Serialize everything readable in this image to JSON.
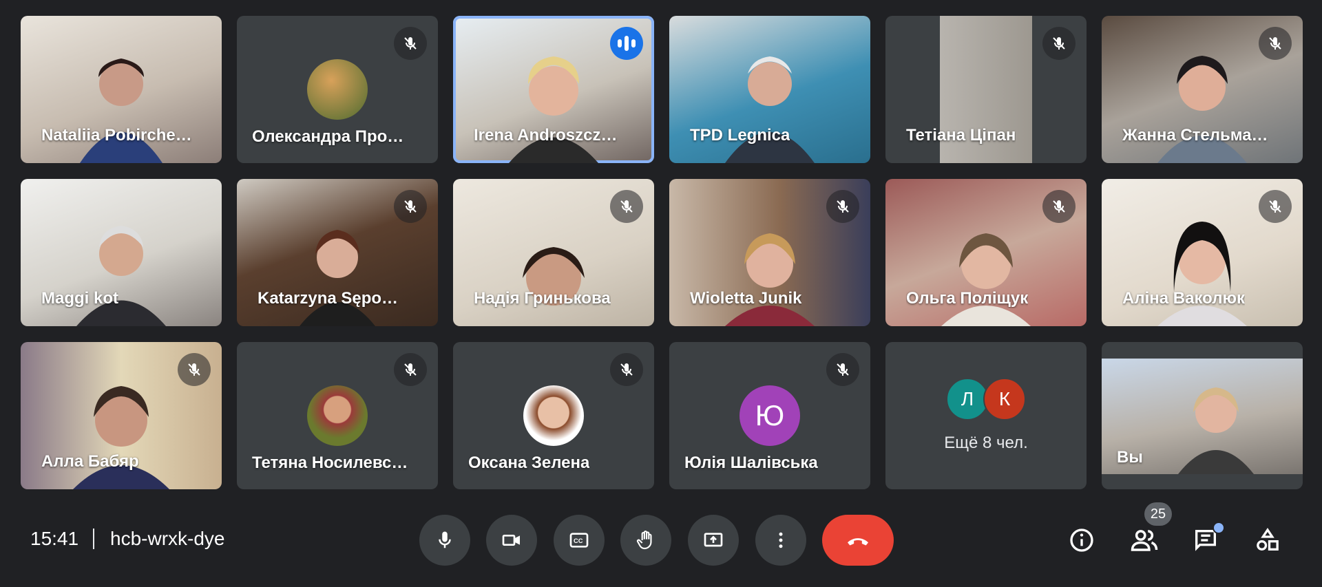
{
  "participants": [
    {
      "name": "Nataliia Pobirche…",
      "muted": false,
      "type": "video"
    },
    {
      "name": "Олександра Про…",
      "muted": true,
      "type": "avatar",
      "avatar_color": "#6d8f4b"
    },
    {
      "name": "Irena Androszcz…",
      "muted": false,
      "speaking": true,
      "type": "video"
    },
    {
      "name": "TPD Legnica",
      "muted": false,
      "type": "video"
    },
    {
      "name": "Тетіана Ціпан",
      "muted": true,
      "type": "video"
    },
    {
      "name": "Жанна Стельма…",
      "muted": true,
      "type": "video"
    },
    {
      "name": "Maggi kot",
      "muted": false,
      "type": "video"
    },
    {
      "name": "Katarzyna Sępo…",
      "muted": true,
      "type": "video"
    },
    {
      "name": "Надія Гринькова",
      "muted": true,
      "type": "video"
    },
    {
      "name": "Wioletta Junik",
      "muted": true,
      "type": "video"
    },
    {
      "name": "Ольга Поліщук",
      "muted": true,
      "type": "video"
    },
    {
      "name": "Аліна Ваколюк",
      "muted": true,
      "type": "video"
    },
    {
      "name": "Алла Бабяр",
      "muted": true,
      "type": "video"
    },
    {
      "name": "Тетяна Носилевс…",
      "muted": true,
      "type": "avatar",
      "avatar_color": "#7a8a3a"
    },
    {
      "name": "Оксана Зелена",
      "muted": true,
      "type": "avatar",
      "avatar_color": "#e8c7b0"
    },
    {
      "name": "Юлія Шалівська",
      "muted": true,
      "type": "initial",
      "initial": "Ю",
      "avatar_color": "#a142b8"
    }
  ],
  "more_tile": {
    "initials": [
      {
        "letter": "Л",
        "color": "#12918b"
      },
      {
        "letter": "К",
        "color": "#c5371d"
      }
    ],
    "text": "Ещё 8 чел."
  },
  "self_tile": {
    "name": "Вы"
  },
  "bottom_bar": {
    "time": "15:41",
    "meeting_code": "hcb-wrxk-dye",
    "controls": [
      "mic-icon",
      "camera-icon",
      "captions-icon",
      "raise-hand-icon",
      "present-screen-icon",
      "more-options-icon"
    ],
    "end_call_icon": "end-call-icon",
    "people_count": "25",
    "colors": {
      "end_call": "#ea4335",
      "accent": "#8ab4f8",
      "control_bg": "#3c4043"
    }
  }
}
